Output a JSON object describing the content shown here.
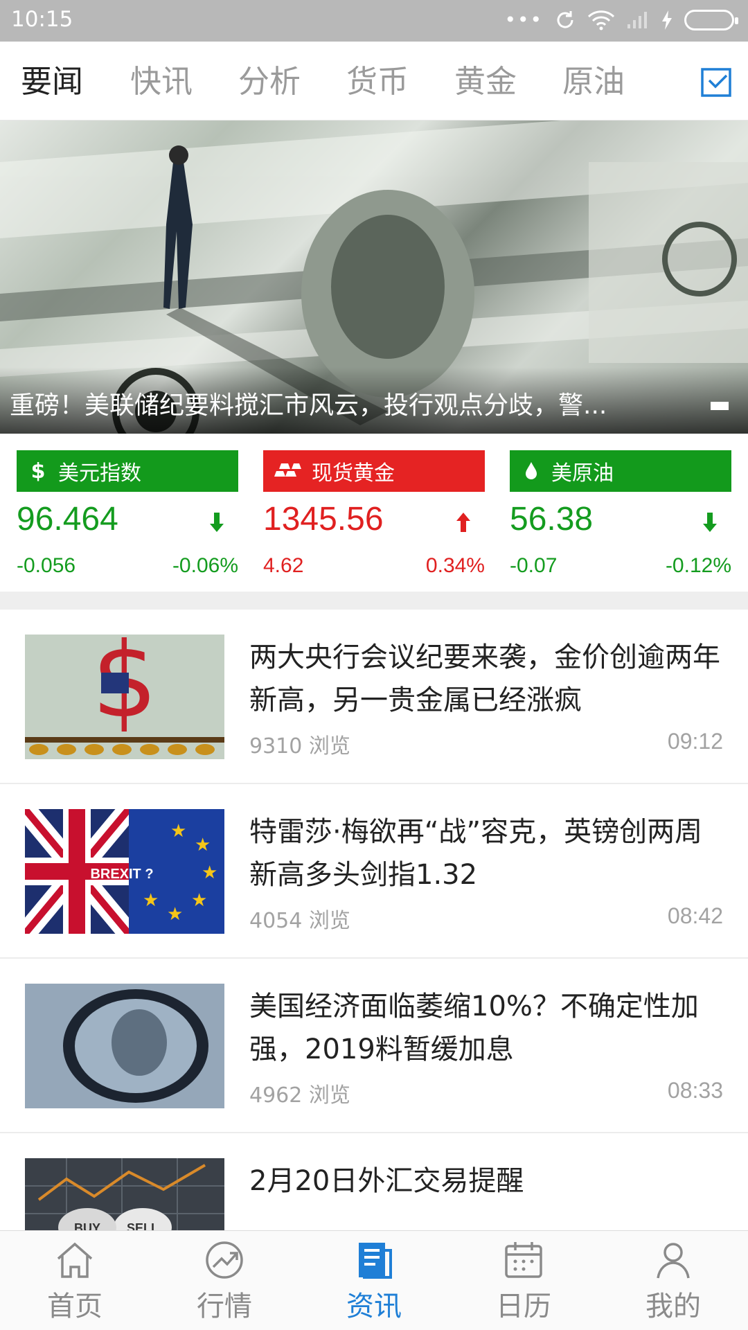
{
  "status_bar": {
    "time": "10:15",
    "dots": "•••"
  },
  "top_tabs": [
    "要闻",
    "快讯",
    "分析",
    "货币",
    "黄金",
    "原油"
  ],
  "banner": {
    "caption": "重磅！美联储纪要料搅汇市风云，投行观点分歧，警..."
  },
  "quotes": [
    {
      "name": "美元指数",
      "icon": "dollar-icon",
      "price": "96.464",
      "change": "-0.056",
      "percent": "-0.06%",
      "direction": "down",
      "color": "#149c1f"
    },
    {
      "name": "现货黄金",
      "icon": "gold-bars-icon",
      "price": "1345.56",
      "change": "4.62",
      "percent": "0.34%",
      "direction": "up",
      "color": "#e02020"
    },
    {
      "name": "美原油",
      "icon": "oil-drop-icon",
      "price": "56.38",
      "change": "-0.07",
      "percent": "-0.12%",
      "direction": "down",
      "color": "#149c1f"
    }
  ],
  "news": [
    {
      "title": "两大央行会议纪要来袭，金价创逾两年新高，另一贵金属已经涨疯",
      "views": "9310 浏览",
      "time": "09:12"
    },
    {
      "title": "特雷莎·梅欲再“战”容克，英镑创两周新高多头剑指1.32",
      "views": "4054 浏览",
      "time": "08:42",
      "thumb_text": "BREXIT ?"
    },
    {
      "title": "美国经济面临萎缩10%？不确定性加强，2019料暂缓加息",
      "views": "4962 浏览",
      "time": "08:33"
    },
    {
      "title": "2月20日外汇交易提醒",
      "thumb_text": "SELL",
      "thumb_text2": "BUY"
    }
  ],
  "bottom_nav": [
    {
      "label": "首页",
      "icon": "home-icon"
    },
    {
      "label": "行情",
      "icon": "trend-icon"
    },
    {
      "label": "资讯",
      "icon": "news-icon",
      "active": true
    },
    {
      "label": "日历",
      "icon": "calendar-icon"
    },
    {
      "label": "我的",
      "icon": "user-icon"
    }
  ],
  "colors": {
    "accent": "#1f7fd6",
    "up": "#e02020",
    "down": "#149c1f"
  }
}
